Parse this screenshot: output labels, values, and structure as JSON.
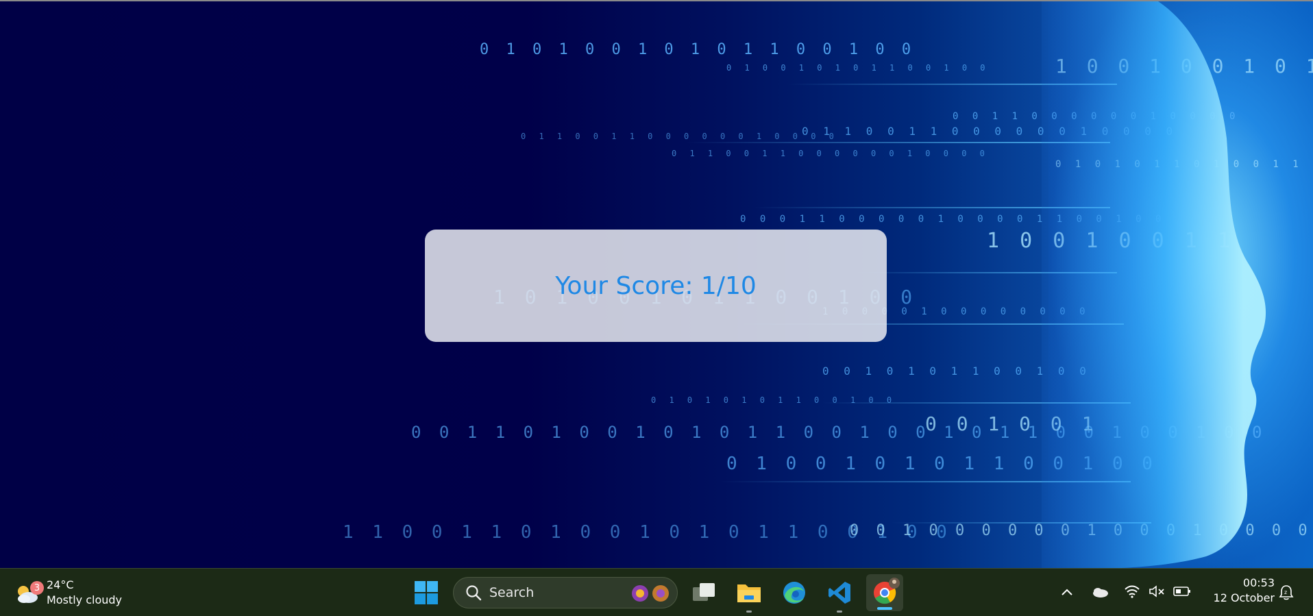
{
  "score": {
    "text": "Your Score: 1/10"
  },
  "taskbar": {
    "weather": {
      "temperature": "24°C",
      "condition": "Mostly cloudy",
      "badge": "3",
      "icon": "weather-cloudy-icon"
    },
    "search": {
      "label": "Search"
    },
    "apps": [
      {
        "name": "start",
        "icon": "windows-icon"
      },
      {
        "name": "task-view",
        "icon": "task-view-icon"
      },
      {
        "name": "file-explorer",
        "icon": "folder-icon"
      },
      {
        "name": "edge",
        "icon": "edge-icon"
      },
      {
        "name": "vscode",
        "icon": "vscode-icon"
      },
      {
        "name": "chrome",
        "icon": "chrome-icon"
      }
    ],
    "clock": {
      "time": "00:53",
      "date": "12 October"
    }
  },
  "colors": {
    "score_text": "#1e88e5",
    "taskbar": "#1c2a16",
    "background": "#000046",
    "accent": "#4cc2ff"
  }
}
